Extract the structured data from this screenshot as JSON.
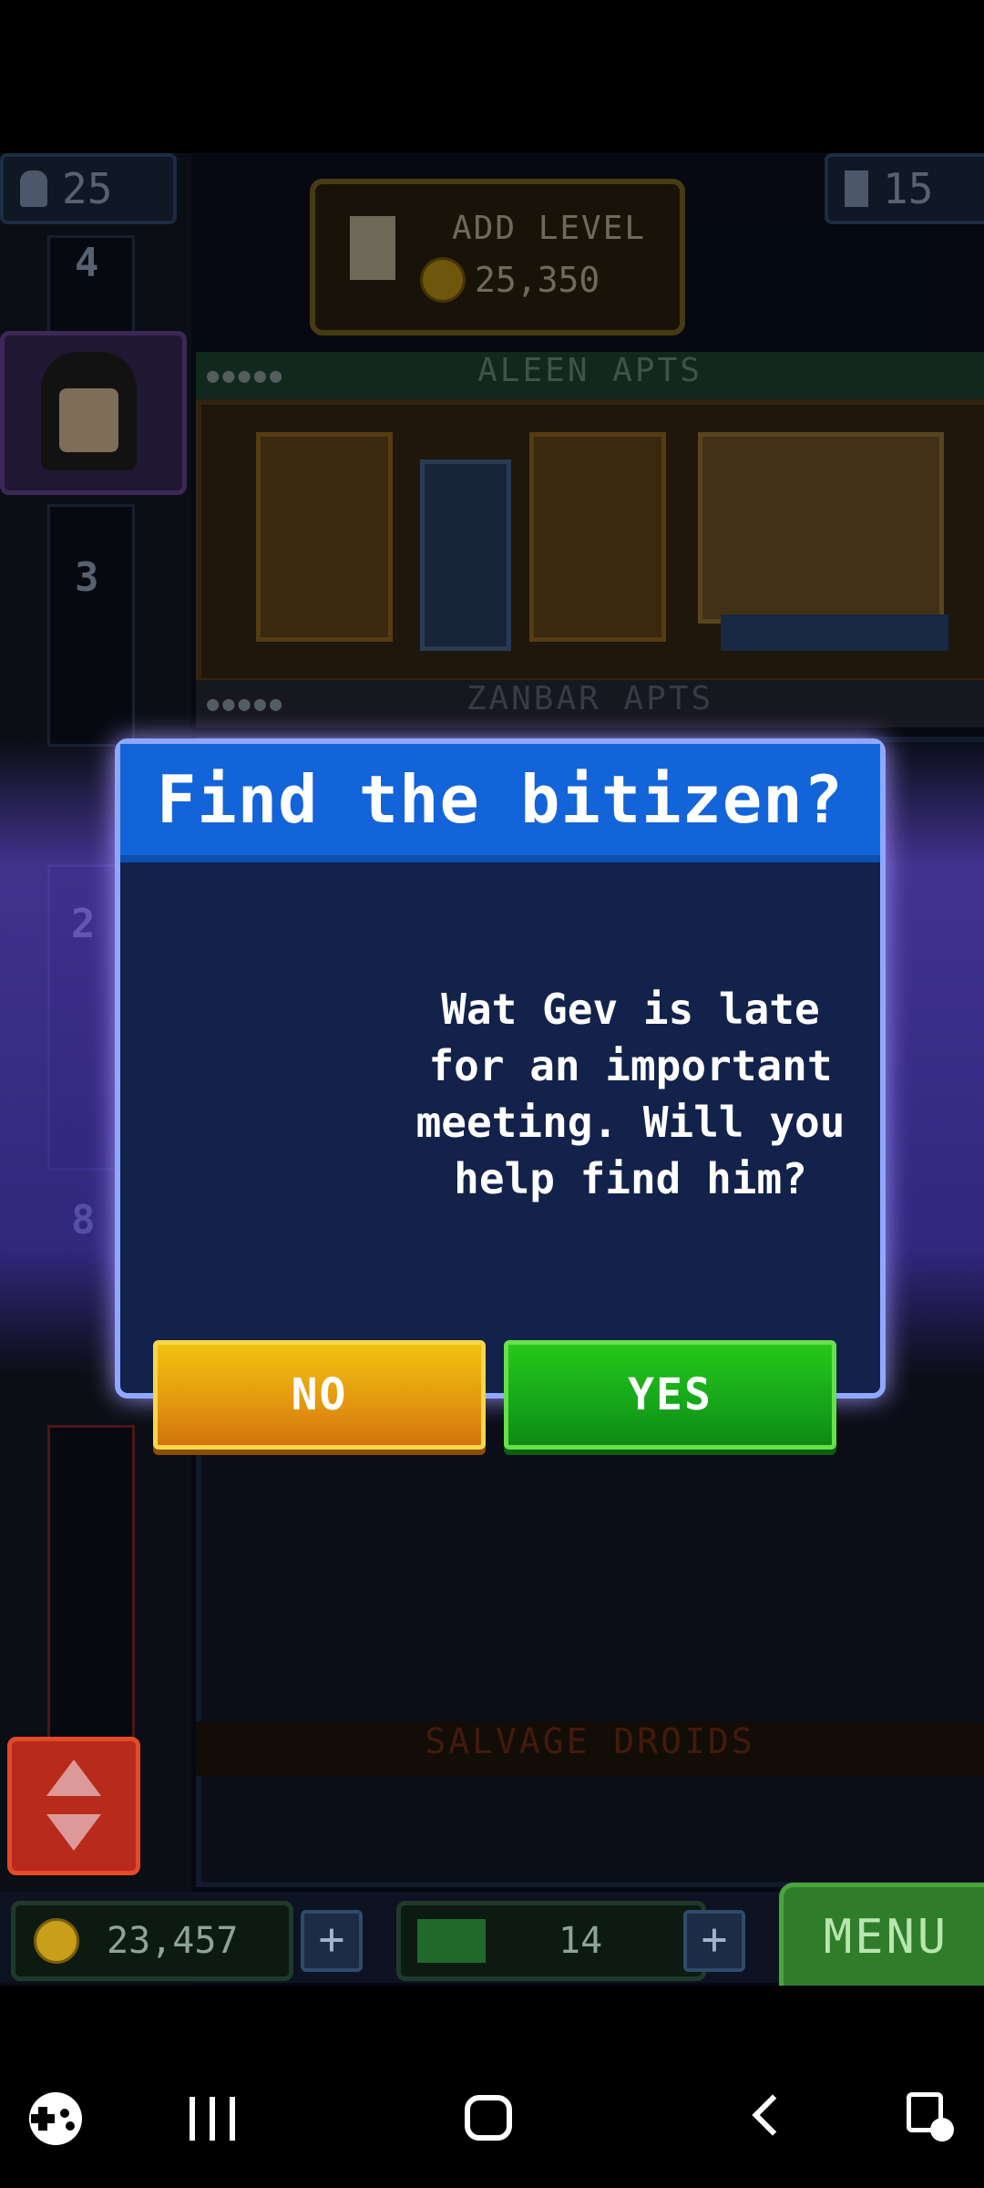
{
  "hud": {
    "residents_count": "25",
    "floors_count": "15",
    "add_level_label": "ADD LEVEL",
    "add_level_cost": "25,350",
    "coins": "23,457",
    "bux": "14",
    "menu_label": "MENU"
  },
  "elevator": {
    "floor_labels": [
      "4",
      "3",
      "2",
      "8"
    ]
  },
  "floors": {
    "names": [
      "ALEEN APTS",
      "ZANBAR APTS",
      "SALVAGE DROIDS"
    ]
  },
  "dialog": {
    "title": "Find the bitizen?",
    "message": "Wat Gev is late for an important meeting. Will you help find him?",
    "no_label": "NO",
    "yes_label": "YES"
  },
  "colors": {
    "dialog_header": "#1464d9",
    "no_button": "#e39610",
    "yes_button": "#16a51a",
    "glow": "#7a5cff"
  },
  "navbar": {
    "icons": [
      "game-launcher-icon",
      "recent-apps-icon",
      "home-icon",
      "back-icon",
      "screen-capture-icon"
    ]
  }
}
